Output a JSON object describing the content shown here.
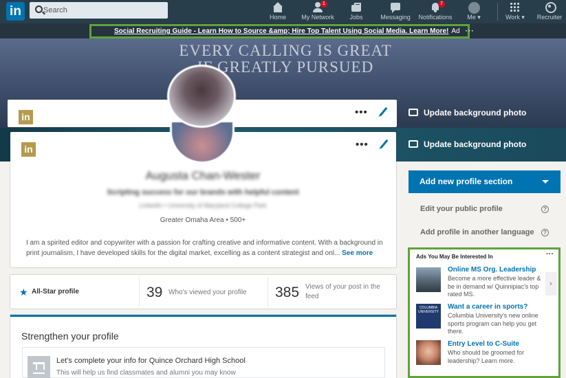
{
  "nav": {
    "logo": "in",
    "search_placeholder": "Search",
    "items": [
      {
        "label": "Home",
        "badge": ""
      },
      {
        "label": "My Network",
        "badge": "1"
      },
      {
        "label": "Jobs",
        "badge": ""
      },
      {
        "label": "Messaging",
        "badge": ""
      },
      {
        "label": "Notifications",
        "badge": "7"
      },
      {
        "label": "Me ▾",
        "badge": ""
      },
      {
        "label": "Work ▾",
        "badge": ""
      },
      {
        "label": "Recruiter",
        "badge": ""
      }
    ]
  },
  "top_ad": {
    "text": "Social Recruiting Guide - Learn How to Source &amp; Hire Top Talent Using Social Media. Learn More!",
    "label": "Ad",
    "more": "···"
  },
  "banner": {
    "line1": "EVERY CALLING IS GREAT",
    "line2": "IF GREATLY PURSUED",
    "update_bg": "Update background photo"
  },
  "profile": {
    "logo": "in",
    "more": "•••",
    "name": "Augusta Chan-Wester",
    "headline": "Scripting success for our brands with helpful content",
    "subline": "LinkedIn • University of Maryland College Park",
    "location": "Greater Omaha Area",
    "connections": "• 500+",
    "summary": "I am a spirited editor and copywriter with a passion for crafting creative and informative content. With a background in print journalism, I have developed skills for the digital market, excelling as a content strategist and onl...",
    "see_more": "See more"
  },
  "stats": {
    "allstar": "All-Star profile",
    "views_num": "39",
    "views_label": "Who's viewed your profile",
    "post_num": "385",
    "post_label": "Views of your post in the feed"
  },
  "strengthen": {
    "title": "Strengthen your profile",
    "item_title": "Let's complete your info for Quince Orchard High School",
    "item_desc": "This will help us find classmates and alumni you may know"
  },
  "right": {
    "add_section": "Add new profile section",
    "edit_public": "Edit your public profile",
    "add_language": "Add profile in another language",
    "help": "?"
  },
  "ads": {
    "header": "Ads You May Be Interested In",
    "more": "···",
    "arrow": "›",
    "items": [
      {
        "title": "Online MS Org. Leadership",
        "desc": "Become a more effective leader & be in demand w/ Quinnipiac's top rated MS."
      },
      {
        "title": "Want a career in sports?",
        "desc": "Columbia University's new online sports program can help you get there."
      },
      {
        "title": "Entry Level to C-Suite",
        "desc": "Who should be groomed for leadership? Learn more."
      }
    ],
    "columbia_logo": "COLUMBIA UNIVERSITY"
  },
  "colors": {
    "nav_bg": "#283e4a",
    "accent": "#0073b1",
    "highlight": "#5fa33a",
    "badge": "#d11124"
  }
}
